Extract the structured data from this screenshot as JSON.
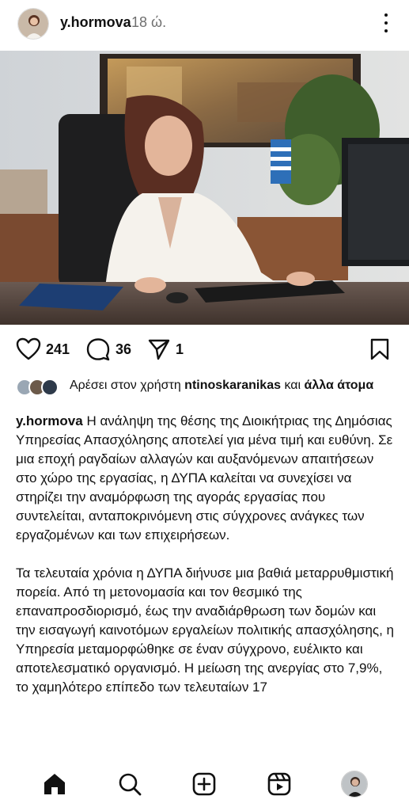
{
  "post": {
    "username": "y.hormova",
    "timestamp": "18 ώ.",
    "likes": "241",
    "comments": "36",
    "shares": "1"
  },
  "liked_by": {
    "prefix": "Αρέσει στον χρήστη",
    "user": "ntinoskaranikas",
    "connector": "και",
    "others": "άλλα άτομα"
  },
  "caption": {
    "username": "y.hormova",
    "paragraph1": "Η ανάληψη της θέσης της Διοικήτριας της Δημόσιας Υπηρεσίας Απασχόλησης αποτελεί για μένα τιμή και ευθύνη. Σε μια εποχή ραγδαίων αλλαγών και αυξανόμενων απαιτήσεων στο χώρο της εργασίας, η ΔΥΠΑ καλείται να συνεχίσει να στηρίζει την αναμόρφωση της αγοράς εργασίας που συντελείται, ανταποκρινόμενη στις σύγχρονες ανάγκες των εργαζομένων και των επιχειρήσεων.",
    "paragraph2": "Τα τελευταία χρόνια η ΔΥΠΑ διήνυσε μια βαθιά μεταρρυθμιστική πορεία. Από τη μετονομασία και τον θεσμικό της επαναπροσδιορισμό, έως την αναδιάρθρωση των δομών και την εισαγωγή καινοτόμων εργαλείων πολιτικής απασχόλησης, η Υπηρεσία μεταμορφώθηκε σε έναν σύγχρονο, ευέλικτο και αποτελεσματικό οργανισμό. Η μείωση της ανεργίας στο 7,9%, το χαμηλότερο επίπεδο των τελευταίων 17"
  },
  "icons": {
    "more": "more-vertical-icon",
    "like": "heart-icon",
    "comment": "comment-bubble-icon",
    "share": "paper-plane-icon",
    "save": "bookmark-icon",
    "nav": [
      "home-icon",
      "search-icon",
      "create-plus-icon",
      "reels-icon",
      "profile-avatar"
    ]
  },
  "colors": {
    "text": "#111111",
    "muted": "#6f6f6f",
    "background": "#ffffff"
  }
}
